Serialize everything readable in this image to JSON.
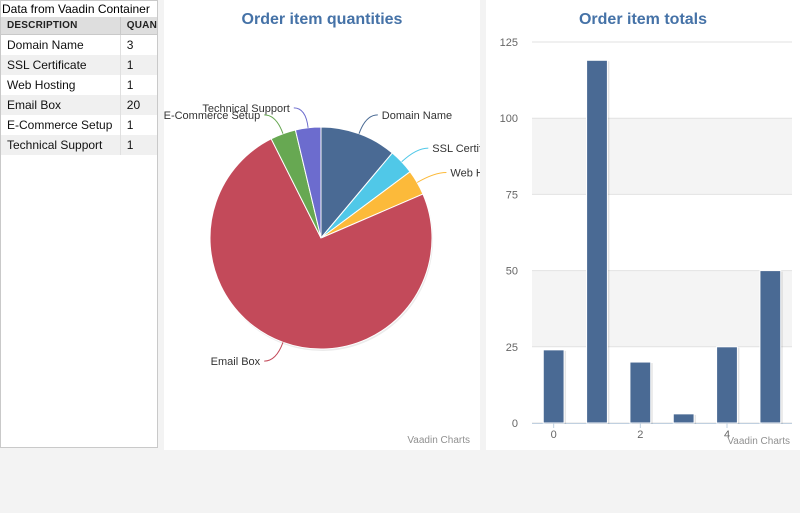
{
  "table": {
    "caption": "Data from Vaadin Container",
    "headers": [
      "DESCRIPTION",
      "QUANTITY"
    ],
    "rows": [
      {
        "description": "Domain Name",
        "quantity": "3"
      },
      {
        "description": "SSL Certificate",
        "quantity": "1"
      },
      {
        "description": "Web Hosting",
        "quantity": "1"
      },
      {
        "description": "Email Box",
        "quantity": "20"
      },
      {
        "description": "E-Commerce Setup",
        "quantity": "1"
      },
      {
        "description": "Technical Support",
        "quantity": "1"
      }
    ]
  },
  "credits": "Vaadin Charts",
  "colors": {
    "title": "#4572a7",
    "palette": [
      "#4a6a94",
      "#50c8e8",
      "#fcba3a",
      "#c34a5a",
      "#67a852",
      "#6c6cce"
    ],
    "bar": "#4a6a94"
  },
  "chart_data": [
    {
      "type": "pie",
      "title": "Order item quantities",
      "labels": [
        "Domain Name",
        "SSL Certificate",
        "Web Hosting",
        "Email Box",
        "E-Commerce Setup",
        "Technical Support"
      ],
      "values": [
        3,
        1,
        1,
        20,
        1,
        1
      ]
    },
    {
      "type": "bar",
      "title": "Order item totals",
      "x": [
        0,
        1,
        2,
        3,
        4,
        5
      ],
      "values": [
        24,
        119,
        20,
        3,
        25,
        50
      ],
      "xticks": [
        0,
        2,
        4
      ],
      "yticks": [
        0,
        25,
        50,
        75,
        100,
        125
      ],
      "ylim": [
        0,
        125
      ],
      "grid": true
    }
  ]
}
